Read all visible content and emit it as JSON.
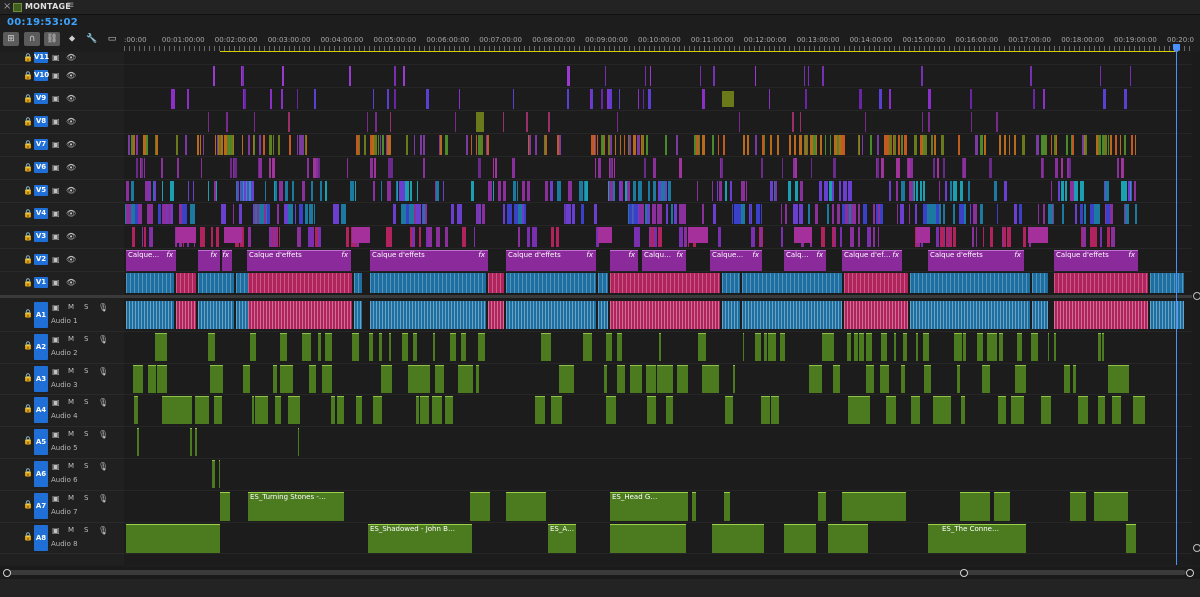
{
  "panel": {
    "close": "×",
    "title": "MONTAGE",
    "menu": "≡"
  },
  "playhead_timecode": "00:19:53:02",
  "tools": [
    {
      "name": "snap-icon",
      "glyph": "⊞"
    },
    {
      "name": "magnet-icon",
      "glyph": "∩"
    },
    {
      "name": "linked-selection-icon",
      "glyph": "⛓"
    },
    {
      "name": "marker-icon",
      "glyph": "⬥"
    },
    {
      "name": "wrench-icon",
      "glyph": "🔧"
    },
    {
      "name": "captions-icon",
      "glyph": "▭"
    }
  ],
  "ruler_labels": [
    ":00:00",
    "00:01:00:00",
    "00:02:00:00",
    "00:03:00:00",
    "00:04:00:00",
    "00:05:00:00",
    "00:06:00:00",
    "00:07:00:00",
    "00:08:00:00",
    "00:09:00:00",
    "00:10:00:00",
    "00:11:00:00",
    "00:12:00:00",
    "00:13:00:00",
    "00:14:00:00",
    "00:15:00:00",
    "00:16:00:00",
    "00:17:00:00",
    "00:18:00:00",
    "00:19:00:00",
    "00:20:0"
  ],
  "video_tracks": [
    "V11",
    "V10",
    "V9",
    "V8",
    "V7",
    "V6",
    "V5",
    "V4",
    "V3",
    "V2",
    "V1"
  ],
  "audio_tracks": [
    {
      "id": "A1",
      "name": "Audio 1"
    },
    {
      "id": "A2",
      "name": "Audio 2"
    },
    {
      "id": "A3",
      "name": "Audio 3"
    },
    {
      "id": "A4",
      "name": "Audio 4"
    },
    {
      "id": "A5",
      "name": "Audio 5"
    },
    {
      "id": "A6",
      "name": "Audio 6"
    },
    {
      "id": "A7",
      "name": "Audio 7"
    },
    {
      "id": "A8",
      "name": "Audio 8"
    }
  ],
  "audio_buttons": {
    "mute": "M",
    "solo": "S"
  },
  "icons": {
    "lock": "🔒",
    "film": "▣",
    "eye": "👁",
    "mic": "🎙"
  },
  "v2_clips": [
    "Calque…",
    "Calque d'effets",
    "Calque d'effets",
    "Calque d'effets",
    "Calqu…",
    "Calque…",
    "Calq…",
    "Calque d'ef…",
    "Calque d'effets",
    "Calque d'effets"
  ],
  "v2_fx": "fx",
  "a7_clips": [
    "ES_Turning Stones -…",
    "ES_Head G…"
  ],
  "a8_clips": [
    "ES_Shadowed - John B…",
    "ES_A…",
    "ES_The Conne…"
  ],
  "colors": {
    "accent": "#1f6fd6",
    "timecode": "#3ea3ff",
    "adjust_layer": "#8b2a9b",
    "audio_clip": "#4b7a1f",
    "video_clip_blue": "#1c6fa0",
    "video_clip_magenta": "#b0235c",
    "work_area": "#d4cf00"
  }
}
